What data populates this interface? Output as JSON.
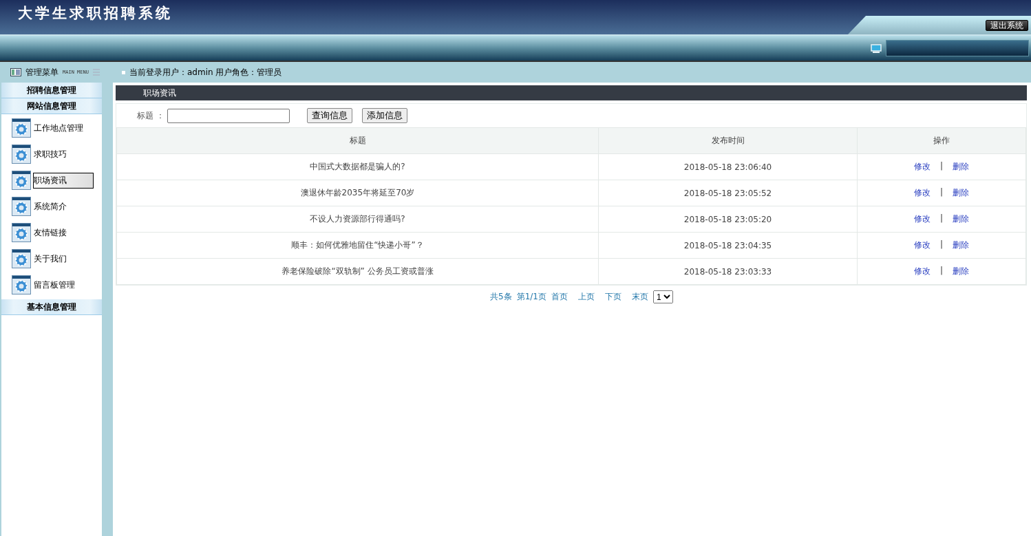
{
  "header": {
    "title": "大学生求职招聘系统",
    "logout_button": "退出系统"
  },
  "menu_header": {
    "title": "管理菜单",
    "subtitle": "MAIN MENU"
  },
  "user_info": "当前登录用户：admin  用户角色：管理员",
  "sidebar": {
    "groups": [
      {
        "label": "招聘信息管理"
      },
      {
        "label": "网站信息管理",
        "children": [
          {
            "label": "工作地点管理",
            "selected": false
          },
          {
            "label": "求职技巧",
            "selected": false
          },
          {
            "label": "职场资讯",
            "selected": true
          },
          {
            "label": "系统简介",
            "selected": false
          },
          {
            "label": "友情链接",
            "selected": false
          },
          {
            "label": "关于我们",
            "selected": false
          },
          {
            "label": "留言板管理",
            "selected": false
          }
        ]
      },
      {
        "label": "基本信息管理"
      }
    ]
  },
  "panel": {
    "title": "职场资讯",
    "search": {
      "label": "标题 ：",
      "buttons": [
        "查询信息",
        "添加信息"
      ]
    },
    "table": {
      "columns": [
        "标题",
        "发布时间",
        "操作"
      ],
      "rows": [
        {
          "title": "中国式大数据都是骗人的?",
          "time": "2018-05-18 23:06:40",
          "actions": [
            "修改",
            "|",
            "删除"
          ]
        },
        {
          "title": "澳退休年龄2035年将延至70岁",
          "time": "2018-05-18 23:05:52",
          "actions": [
            "修改",
            "|",
            "删除"
          ]
        },
        {
          "title": "不设人力资源部行得通吗?",
          "time": "2018-05-18 23:05:20",
          "actions": [
            "修改",
            "|",
            "删除"
          ]
        },
        {
          "title": "顺丰：如何优雅地留住“快递小哥”？",
          "time": "2018-05-18 23:04:35",
          "actions": [
            "修改",
            "|",
            "删除"
          ]
        },
        {
          "title": "养老保险破除“双轨制” 公务员工资或普涨",
          "time": "2018-05-18 23:03:33",
          "actions": [
            "修改",
            "|",
            "删除"
          ]
        }
      ]
    },
    "pagination": {
      "total": "共5条",
      "page": "第1/1页",
      "links": [
        "首页",
        "上页",
        "下页",
        "末页"
      ],
      "page_select": "1"
    }
  }
}
